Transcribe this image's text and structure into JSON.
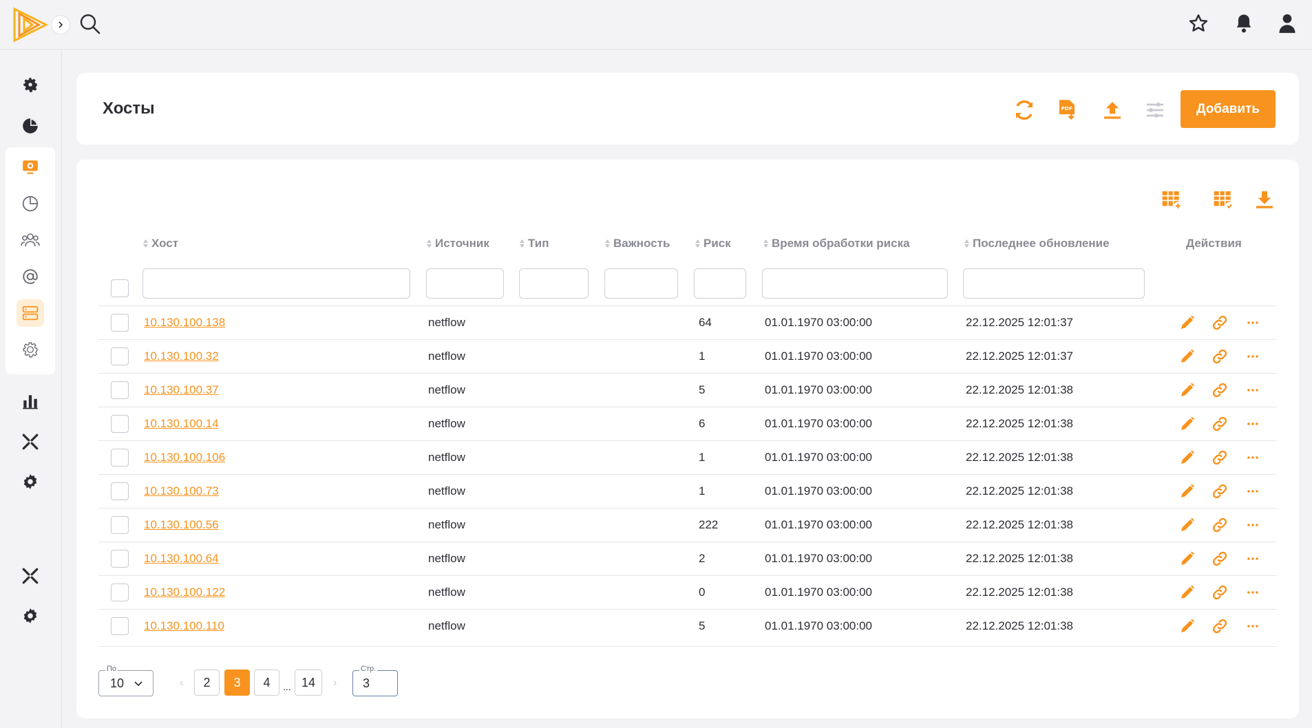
{
  "colors": {
    "accent": "#f7931e",
    "icon_dark": "#2c2c34",
    "muted": "#8a8a95"
  },
  "header": {
    "title": "Хосты",
    "add_label": "Добавить"
  },
  "columns": [
    "Хост",
    "Источник",
    "Тип",
    "Важность",
    "Риск",
    "Время обработки риска",
    "Последнее обновление",
    "Действия"
  ],
  "rows": [
    {
      "host": "10.130.100.138",
      "source": "netflow",
      "type": "",
      "severity": "",
      "risk": "64",
      "risk_time": "01.01.1970 03:00:00",
      "updated": "22.12.2025 12:01:37"
    },
    {
      "host": "10.130.100.32",
      "source": "netflow",
      "type": "",
      "severity": "",
      "risk": "1",
      "risk_time": "01.01.1970 03:00:00",
      "updated": "22.12.2025 12:01:37"
    },
    {
      "host": "10.130.100.37",
      "source": "netflow",
      "type": "",
      "severity": "",
      "risk": "5",
      "risk_time": "01.01.1970 03:00:00",
      "updated": "22.12.2025 12:01:38"
    },
    {
      "host": "10.130.100.14",
      "source": "netflow",
      "type": "",
      "severity": "",
      "risk": "6",
      "risk_time": "01.01.1970 03:00:00",
      "updated": "22.12.2025 12:01:38"
    },
    {
      "host": "10.130.100.106",
      "source": "netflow",
      "type": "",
      "severity": "",
      "risk": "1",
      "risk_time": "01.01.1970 03:00:00",
      "updated": "22.12.2025 12:01:38"
    },
    {
      "host": "10.130.100.73",
      "source": "netflow",
      "type": "",
      "severity": "",
      "risk": "1",
      "risk_time": "01.01.1970 03:00:00",
      "updated": "22.12.2025 12:01:38"
    },
    {
      "host": "10.130.100.56",
      "source": "netflow",
      "type": "",
      "severity": "",
      "risk": "222",
      "risk_time": "01.01.1970 03:00:00",
      "updated": "22.12.2025 12:01:38"
    },
    {
      "host": "10.130.100.64",
      "source": "netflow",
      "type": "",
      "severity": "",
      "risk": "2",
      "risk_time": "01.01.1970 03:00:00",
      "updated": "22.12.2025 12:01:38"
    },
    {
      "host": "10.130.100.122",
      "source": "netflow",
      "type": "",
      "severity": "",
      "risk": "0",
      "risk_time": "01.01.1970 03:00:00",
      "updated": "22.12.2025 12:01:38"
    },
    {
      "host": "10.130.100.110",
      "source": "netflow",
      "type": "",
      "severity": "",
      "risk": "5",
      "risk_time": "01.01.1970 03:00:00",
      "updated": "22.12.2025 12:01:38"
    }
  ],
  "pagination": {
    "per_page_label": "По",
    "per_page": "10",
    "pages": [
      "2",
      "3",
      "4",
      "14"
    ],
    "current": "3",
    "ellipsis": "...",
    "goto_label": "Стр.",
    "goto_value": "3"
  },
  "icons": {
    "top": [
      "logo",
      "search-icon",
      "star-icon",
      "bell-icon",
      "user-icon"
    ],
    "sidebar": [
      "settings-gear-icon",
      "pie-chart-icon",
      "monitor-icon",
      "pie-outline-icon",
      "users-group-icon",
      "at-sign-icon",
      "server-icon",
      "gear-outline-icon",
      "bar-chart-icon",
      "tools-icon",
      "cog-badge-icon",
      "tools-icon",
      "cog-badge-icon"
    ],
    "header": [
      "refresh-icon",
      "pdf-export-icon",
      "upload-icon",
      "filter-settings-icon"
    ],
    "table": [
      "table-add-icon",
      "table-check-icon",
      "download-icon"
    ],
    "row_actions": [
      "edit-pencil-icon",
      "link-icon",
      "more-dots-icon"
    ]
  }
}
